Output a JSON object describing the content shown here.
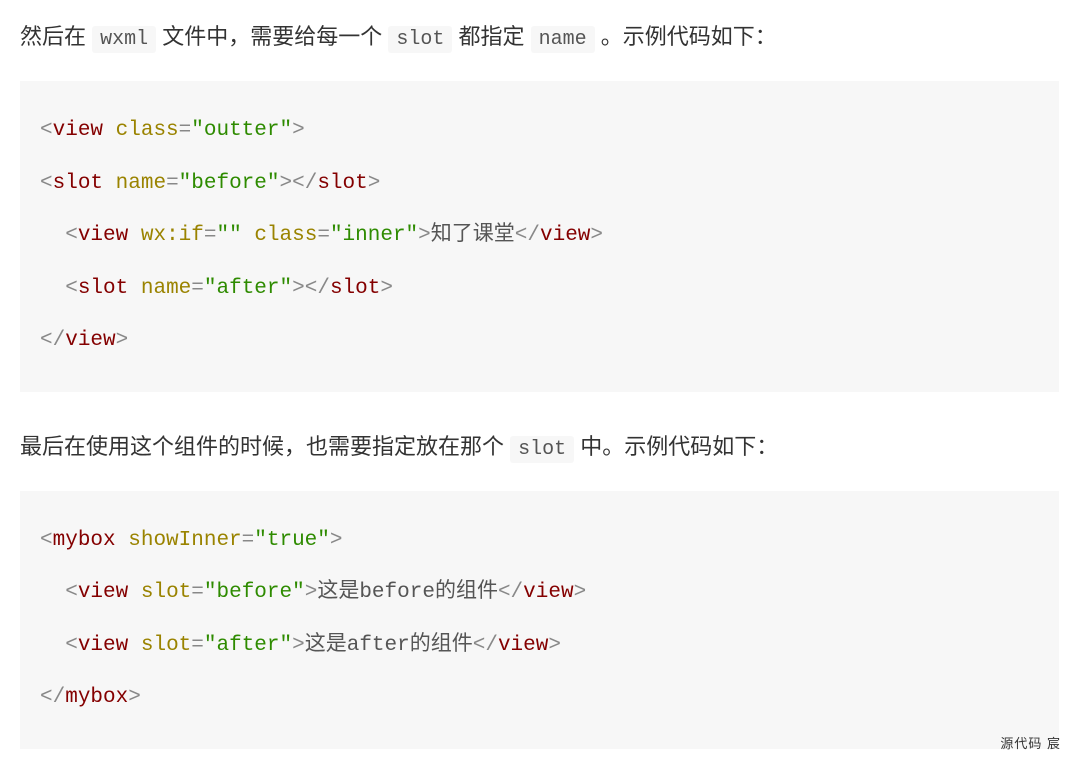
{
  "para1": {
    "t1": "然后在 ",
    "c1": "wxml",
    "t2": " 文件中，需要给每一个 ",
    "c2": "slot",
    "t3": " 都指定 ",
    "c3": "name",
    "t4": " 。示例代码如下："
  },
  "code1": {
    "l1": {
      "b1": "<",
      "tag": "view",
      "sp": " ",
      "a1": "class",
      "eq": "=",
      "v1": "\"outter\"",
      "b2": ">"
    },
    "l2": {
      "b1": "<",
      "tag": "slot",
      "sp": " ",
      "a1": "name",
      "eq": "=",
      "v1": "\"before\"",
      "b2": ">",
      "cb1": "</",
      "ctag": "slot",
      "cb2": ">"
    },
    "l3": {
      "indent": "  ",
      "b1": "<",
      "tag": "view",
      "sp": " ",
      "a1": "wx:if",
      "eq1": "=",
      "v1": "\"\"",
      "sp2": " ",
      "a2": "class",
      "eq2": "=",
      "v2": "\"inner\"",
      "b2": ">",
      "txt": "知了课堂",
      "cb1": "</",
      "ctag": "view",
      "cb2": ">"
    },
    "l4": {
      "indent": "  ",
      "b1": "<",
      "tag": "slot",
      "sp": " ",
      "a1": "name",
      "eq": "=",
      "v1": "\"after\"",
      "b2": ">",
      "cb1": "</",
      "ctag": "slot",
      "cb2": ">"
    },
    "l5": {
      "cb1": "</",
      "ctag": "view",
      "cb2": ">"
    }
  },
  "para2": {
    "t1": "最后在使用这个组件的时候，也需要指定放在那个 ",
    "c1": "slot",
    "t2": " 中。示例代码如下："
  },
  "code2": {
    "l1": {
      "b1": "<",
      "tag": "mybox",
      "sp": " ",
      "a1": "showInner",
      "eq": "=",
      "v1": "\"true\"",
      "b2": ">"
    },
    "l2": {
      "indent": "  ",
      "b1": "<",
      "tag": "view",
      "sp": " ",
      "a1": "slot",
      "eq": "=",
      "v1": "\"before\"",
      "b2": ">",
      "txt": "这是before的组件",
      "cb1": "</",
      "ctag": "view",
      "cb2": ">"
    },
    "l3": {
      "indent": "  ",
      "b1": "<",
      "tag": "view",
      "sp": " ",
      "a1": "slot",
      "eq": "=",
      "v1": "\"after\"",
      "b2": ">",
      "txt": "这是after的组件",
      "cb1": "</",
      "ctag": "view",
      "cb2": ">"
    },
    "l4": {
      "cb1": "</",
      "ctag": "mybox",
      "cb2": ">"
    }
  },
  "watermark": "源代码   宸"
}
